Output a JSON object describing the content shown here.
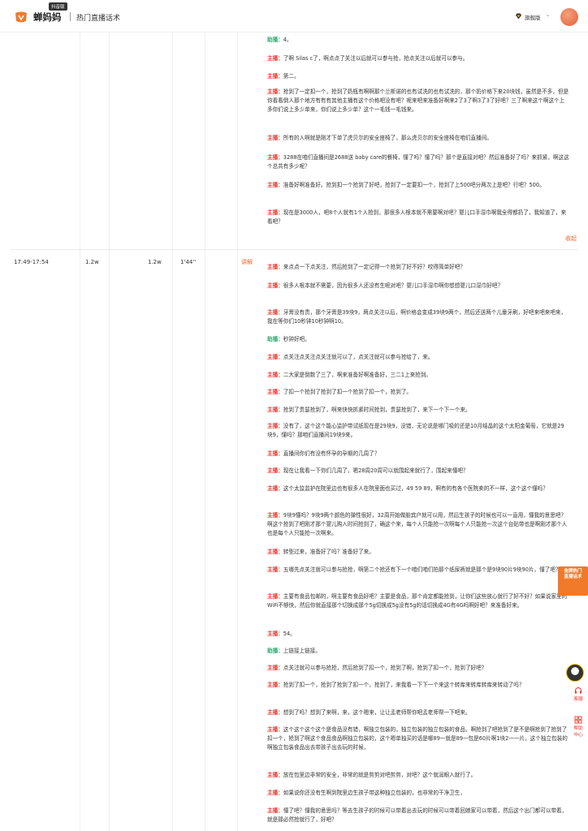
{
  "header": {
    "brand": "蝉妈妈",
    "badge": "抖音版",
    "title": "热门直播话术",
    "vip_label": "旗舰版"
  },
  "colors": {
    "brand": "#e8662e",
    "anchor": "#e8382e",
    "assist": "#2aa86a"
  },
  "row2": {
    "time": "17:49-17:54",
    "col2": "1.2w",
    "col3": "1.2w",
    "duration": "1'44''",
    "tag": "讲解"
  },
  "collapse_label": "收起",
  "promo": {
    "line1": "金牌热门",
    "line2": "直播话术"
  },
  "side": {
    "feedback": "客服",
    "help": "帮助中心"
  },
  "top_lines": [
    {
      "role": "助播：",
      "type": "assist",
      "text": "4。"
    },
    {
      "role": "主播：",
      "type": "anchor",
      "text": "了啊 Silas c了，啊点点了关注以后就可以参与抢，抢点关注以后就可以参与。"
    },
    {
      "role": "主播：",
      "type": "anchor",
      "text": "第二。"
    },
    {
      "role": "主播：",
      "type": "anchor",
      "text": "抢到了一定扣一个，抢到了奶瓶有啊啊那个兰斯诺的也有试洗的也有试洗的，那个奶价格下来20块钱，虽然是不多，但是你看看倒人那个地方有有有其他主播有这个价格吧没有吧？呢来吧来准备好啊来2了3了啊3了3了好吧？三了啊来这个啊这个上多你们说上多少单来，你们说上多少单？这个一毛钱一毛钱来。"
    },
    {
      "role": "主播：",
      "type": "anchor",
      "text": "所有的人啊就是刚才下单了虎贝尔的安全座椅了，那么虎贝尔的安全座椅在咱们直播间。"
    },
    {
      "role": "主播：",
      "type": "anchor",
      "text": "3288在咱们直播间是2688送 baby care的餐椅，懂了吗？懂了吗？那个是直接对吧？然后准备好了吗？来抓紧，啊这这个总共有多少呢？"
    },
    {
      "role": "主播：",
      "type": "anchor",
      "text": "准备好啊准备好。抢到扣一个抢到了好吧，抢到了一定要扣一个，抢到了上500吧分两次上是吧？行吧？500。"
    },
    {
      "role": "主播：",
      "type": "anchor",
      "text": "现在是3000人，吧8个人就有1个人抢到，那很多人根本就不需要啊对吧？婴儿口手湿巾啊我全得都扔了，我知道了，来看吧？"
    }
  ],
  "bottom_lines": [
    {
      "role": "主播：",
      "type": "anchor",
      "text": "来点点一下点关注，然后抢到了一定记得一个抢到了好不好？咬得简单好吧？"
    },
    {
      "role": "主播：",
      "type": "anchor",
      "text": "很多人根本就不需要，因为很多人还没有生呢对吧？婴儿口手湿巾啊你想想婴儿口湿巾好吧？"
    },
    {
      "role": "主播：",
      "type": "anchor",
      "text": "牙膏没有贵，那个牙膏是39块9，两点关注以后，啊价格会变成39块9两个，然后还送两个儿童牙刷，好吧来吧来吧来，我在等你们10秒钟10秒钟啊10。"
    },
    {
      "role": "助播：",
      "type": "assist",
      "text": "秒钟好吧。"
    },
    {
      "role": "主播：",
      "type": "anchor",
      "text": "点关注点关注点关注就可以了，点关注就可以参与抢给了，来。"
    },
    {
      "role": "主播：",
      "type": "anchor",
      "text": "二大家是倒数了三了，啊来准备好啊准备好，三二1上来抢到。"
    },
    {
      "role": "主播：",
      "type": "anchor",
      "text": "了扣一个抢到了抢到了扣一个抢到了扣一个，抢到了。"
    },
    {
      "role": "主播：",
      "type": "anchor",
      "text": "抢到了贵瑟抢到了，啊来快快抓紧时间抢到，贵瑟抢到了，来下一个下一个来。"
    },
    {
      "role": "主播：",
      "type": "anchor",
      "text": "没有了，这个这个能心监护带试纸现在是29块9，没错，无论说是哪门吸的还是10月结晶的这个太阳金葡萄，它就是29块9，懂吗？那咱们直播间19块9来。"
    },
    {
      "role": "主播：",
      "type": "anchor",
      "text": "直播间你们有没有怀孕的孕期的几周了？"
    },
    {
      "role": "主播：",
      "type": "anchor",
      "text": "现在让我看一下你们几周了，嗯28周20周可以就围起来就行了，围起来懂吧？"
    },
    {
      "role": "主播：",
      "type": "anchor",
      "text": "这个太监监护在院里边也有很多人在院里面也买过，49 59 89，啊有的有各个医院卖的不一样，这个这个懂吗？"
    },
    {
      "role": "主播：",
      "type": "anchor",
      "text": "9块9懂吗？9块9两个颜色的弹性很好，32周开始做胎宾户就可以用，然后生孩子的时候也可以一直用，懂我的意思吧？啊这个抢到了吧刚才那个婴儿购入时间抢到了，确这个来，每个人只能抢一次啊每个人只能抢一次这个台贴带也是啊刚才那个人也是每个人只能抢一次啊来。"
    },
    {
      "role": "主播：",
      "type": "anchor",
      "text": "转型过来，准备好了吗？准备好了来。"
    },
    {
      "role": "主播：",
      "type": "anchor",
      "text": "五哪先点关注就可以参与抢抢，啊第二个抢还有下一个咱们咱们拍那个纸尿裤就是那个是9块90片9块90片，懂了吧？"
    },
    {
      "role": "主播：",
      "type": "anchor",
      "text": "主要有食品包邮的，啊主要有食品好吧？主要是食品，那个肯定都能抢到，让你们这些放心就行了好不好？如果说家里的WiFi不够快，然后你就直接那个切换成那个5g切换成5g没有5g的话切换成4G有4G吗啊好吧？来准备好来。"
    },
    {
      "role": "主播：",
      "type": "anchor",
      "text": "54。"
    },
    {
      "role": "助播：",
      "type": "assist",
      "text": "上链接上链接。"
    },
    {
      "role": "主播：",
      "type": "anchor",
      "text": "点关注就可以参与抢抢，然后抢到了扣一个，抢到了啊，抢到了扣一个，抢到了好吧？"
    },
    {
      "role": "主播：",
      "type": "anchor",
      "text": "抢到了扣一个，抢到了抢到了扣一个，抢到了，来我看一下下一个来这个转库来转库转库来转动了吗？"
    },
    {
      "role": "主播：",
      "type": "anchor",
      "text": "想到了吗？想到了来啊，来，这个嗯来，让让孟老师帮你吧孟老师帮一下吧来。"
    },
    {
      "role": "主播：",
      "type": "anchor",
      "text": "这个这个这个这个是食品没有错，啊独立包装的，独立包装的独立包装的食品，啊抢到了吧抢到了是不是啊抢到了抢到了扣一个，抢到了啊这个食品食品啊独立包装的，这个嗯单独买的话是哪89一就是89一包是60片啊1块2一一片，这个独立包装的啊独立包装食品出去带孩子出去玩的时候，"
    },
    {
      "role": "主播：",
      "type": "anchor",
      "text": "放在包里边非常的安全，非常的就是剪剪对吧剪剪，对吧？这个就润眼入就行了。"
    },
    {
      "role": "主播：",
      "type": "anchor",
      "text": "如果说你还没有生啊到院里边生孩子带这种独立包装的，也非常的干净卫生，"
    },
    {
      "role": "主播：",
      "type": "anchor",
      "text": "懂了吧？懂我的意思吗？等去生孩子的时候可以带着出去玩的时候可以带着回娘家可以带着，然后这个出门都可以带着，就是那必然抢就行了，好吧？"
    }
  ]
}
